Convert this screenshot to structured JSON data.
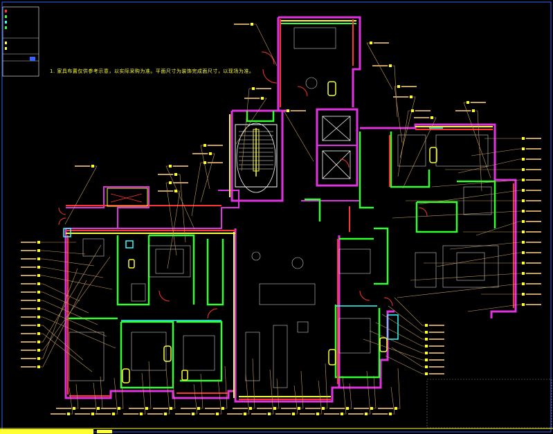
{
  "drawing": {
    "note": "1. 家具布置仅供参考示意，以实际采购为准。平面尺寸为装饰完成面尺寸，以现场为准。",
    "annotation_count": 170
  },
  "colors": {
    "background": "#000000",
    "wall_magenta": "#e033e0",
    "wall_green": "#33ff33",
    "wall_red": "#ff3333",
    "wall_yellow": "#ffff33",
    "cyan": "#33ffff",
    "leader_brown": "#c8a060",
    "white": "#ffffff",
    "frame_blue": "#3366ff",
    "dashed_gray": "#888888"
  },
  "icons": {
    "stair": "stair-icon",
    "elevator": "elevator-icon",
    "door_swing": "door-swing-icon",
    "toilet": "toilet-icon"
  }
}
